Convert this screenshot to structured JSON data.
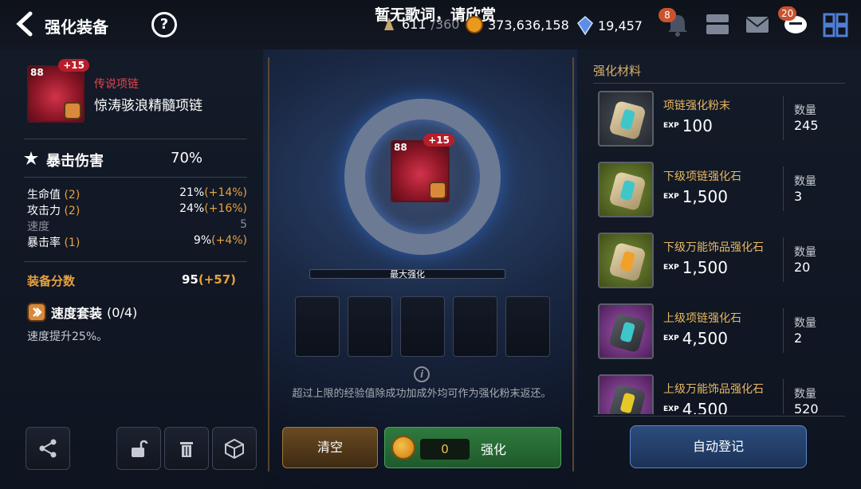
{
  "header": {
    "title": "强化装备",
    "help_label": "?",
    "lyric": "暂无歌词，请欣赏",
    "stamina": "611",
    "stamina_max": "/360",
    "gold": "373,636,158",
    "crystals": "19,457",
    "notif_count": "8",
    "chat_count": "20",
    "icons": [
      "back-icon",
      "help-icon",
      "stamina-icon",
      "gold-coin-icon",
      "crystal-icon",
      "bell-icon",
      "friends-icon",
      "mail-icon",
      "chat-icon",
      "menu-grid-icon"
    ]
  },
  "item": {
    "level": "88",
    "plus": "+15",
    "rarity": "传说项链",
    "name": "惊涛骇浪精髓项链",
    "main_stat_label": "暴击伤害",
    "main_stat_value": "70%"
  },
  "stats": [
    {
      "name": "生命值",
      "sub": "(2)",
      "value": "21%",
      "bonus": "(+14%)"
    },
    {
      "name": "攻击力",
      "sub": "(2)",
      "value": "24%",
      "bonus": "(+16%)"
    },
    {
      "name": "速度",
      "sub": "",
      "value": "5",
      "bonus": ""
    },
    {
      "name": "暴击率",
      "sub": "(1)",
      "value": "9%",
      "bonus": "(+4%)"
    }
  ],
  "score": {
    "label": "装备分数",
    "value": "95",
    "bonus": "(+57)"
  },
  "set": {
    "name": "速度套装",
    "progress": "(0/4)",
    "desc": "速度提升25%。"
  },
  "middle": {
    "max_label": "最大强化",
    "note": "超过上限的经验值除成功加成外均可作为强化粉末返还。",
    "clear_label": "清空",
    "cost": "0",
    "enhance_label": "强化"
  },
  "materials": {
    "title": "强化材料",
    "qty_label": "数量",
    "exp_label": "EXP",
    "list": [
      {
        "name": "项链强化粉末",
        "exp": "100",
        "qty": "245"
      },
      {
        "name": "下级项链强化石",
        "exp": "1,500",
        "qty": "3"
      },
      {
        "name": "下级万能饰品强化石",
        "exp": "1,500",
        "qty": "20"
      },
      {
        "name": "上级项链强化石",
        "exp": "4,500",
        "qty": "2"
      },
      {
        "name": "上级万能饰品强化石",
        "exp": "4,500",
        "qty": "520"
      }
    ],
    "auto_label": "自动登记"
  }
}
